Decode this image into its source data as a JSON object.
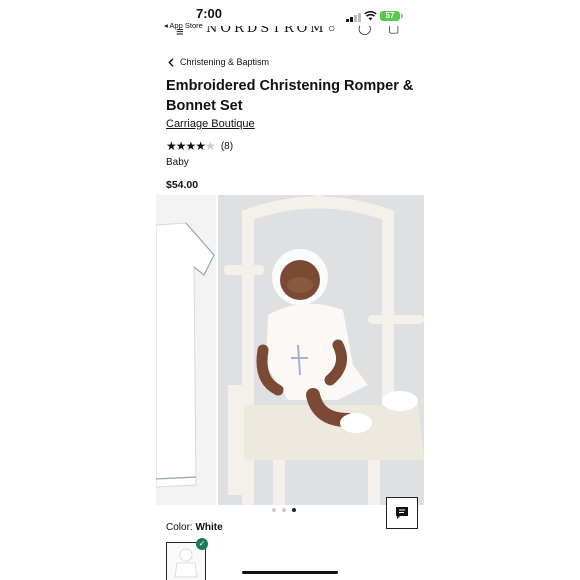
{
  "status_bar": {
    "time": "7:00",
    "back_app": "◂ App Store",
    "battery": "57"
  },
  "nav": {
    "brand": "NORDSTROM"
  },
  "breadcrumb": {
    "label": "Christening & Baptism"
  },
  "product": {
    "title": "Embroidered Christening Romper & Bonnet Set",
    "brand": "Carriage Boutique",
    "rating_value": 4,
    "rating_count": "(8)",
    "category": "Baby",
    "price": "$54.00"
  },
  "gallery": {
    "image_count": 3,
    "active_index": 2
  },
  "color": {
    "label": "Color:",
    "value": "White"
  },
  "icons": [
    "menu-icon",
    "search-icon",
    "account-icon",
    "bag-icon",
    "chevron-left-icon",
    "star-icon",
    "chat-icon",
    "check-icon"
  ],
  "colors": {
    "check": "#1f7a5a",
    "battery": "#59c84f"
  }
}
